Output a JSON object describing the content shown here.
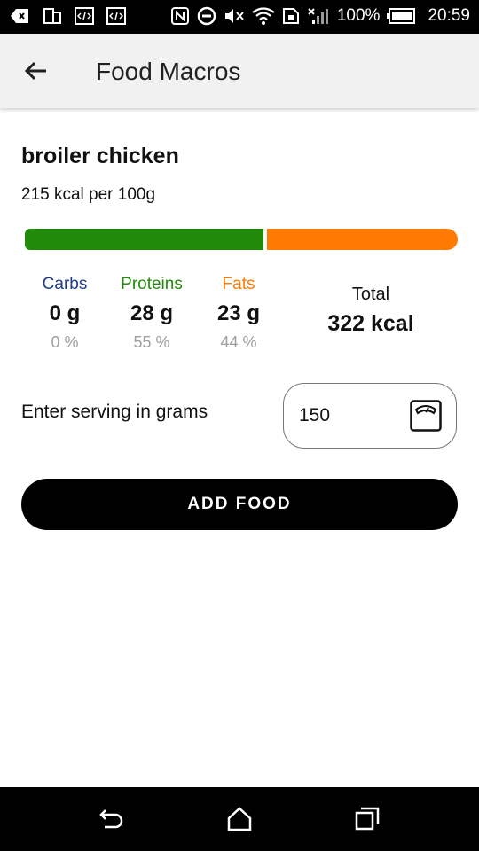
{
  "status_bar": {
    "battery": "100%",
    "time": "20:59"
  },
  "app_bar": {
    "title": "Food Macros",
    "back_icon": "arrow-back-icon"
  },
  "food": {
    "name": "broiler chicken",
    "kcal_per": "215 kcal per 100g"
  },
  "colors": {
    "carbs": "#1e3c8c",
    "proteins": "#218a0b",
    "fats": "#ff7a00"
  },
  "macro_bar": {
    "proteins_fraction": 0.55,
    "fats_fraction": 0.44
  },
  "macros": {
    "carbs": {
      "label": "Carbs",
      "value": "0 g",
      "percent": "0 %"
    },
    "proteins": {
      "label": "Proteins",
      "value": "28 g",
      "percent": "55 %"
    },
    "fats": {
      "label": "Fats",
      "value": "23 g",
      "percent": "44 %"
    }
  },
  "total": {
    "label": "Total",
    "value": "322 kcal"
  },
  "serving": {
    "label": "Enter serving in grams",
    "value": "150",
    "icon": "scale-icon"
  },
  "add_button": {
    "label": "ADD FOOD"
  },
  "nav": {
    "back_icon": "back-icon",
    "home_icon": "home-icon",
    "recents_icon": "recents-icon"
  }
}
